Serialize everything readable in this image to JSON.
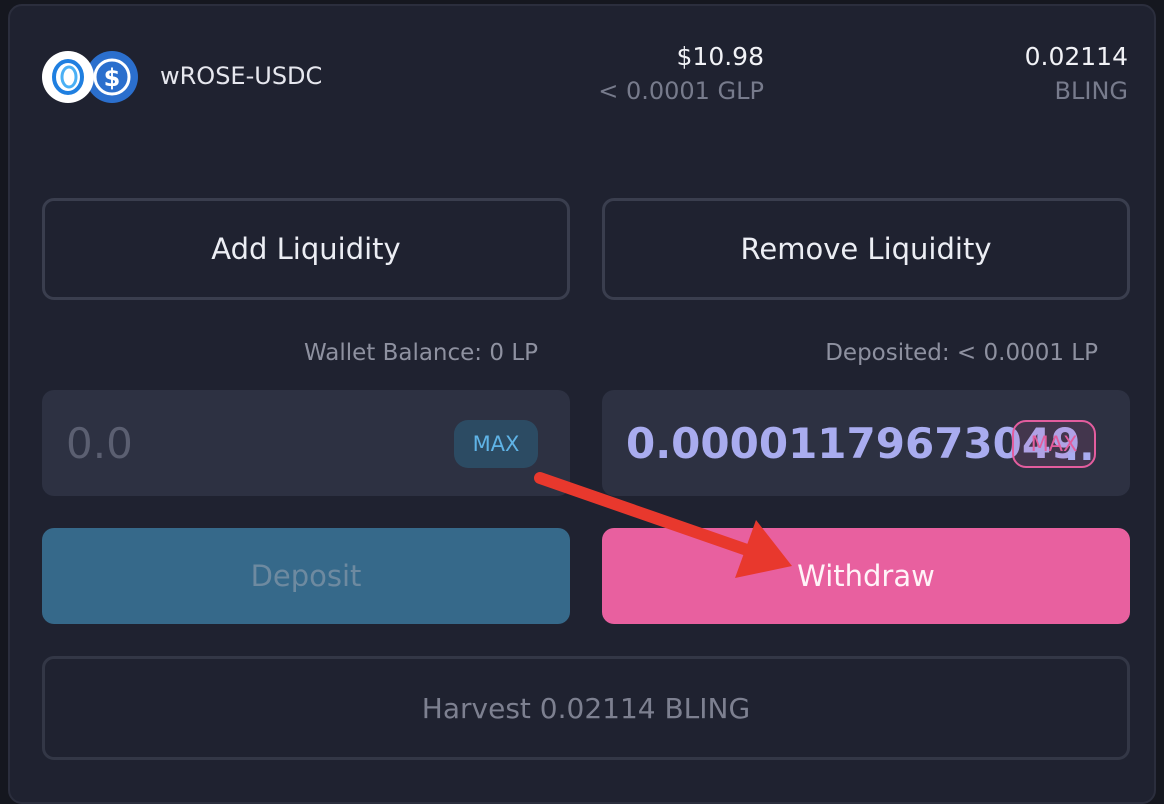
{
  "pool": {
    "pair_name": "wROSE-USDC",
    "tokens": [
      {
        "name": "wROSE",
        "icon": "rose-token-icon",
        "color": "#2b6fcd"
      },
      {
        "name": "USDC",
        "icon": "usdc-token-icon",
        "color": "#2b6fcd"
      }
    ],
    "tvl_value": "$10.98",
    "tvl_sub": "< 0.0001 GLP",
    "reward_value": "0.02114",
    "reward_sub": "BLING"
  },
  "tabs": {
    "add_label": "Add Liquidity",
    "remove_label": "Remove Liquidity"
  },
  "deposit_panel": {
    "balance_label": "Wallet Balance: 0 LP",
    "input_placeholder": "0.0",
    "max_label": "MAX",
    "button_label": "Deposit"
  },
  "withdraw_panel": {
    "balance_label": "Deposited: < 0.0001 LP",
    "input_value": "0.00001179673049",
    "ellipsis": "..",
    "max_label": "MAX",
    "button_label": "Withdraw"
  },
  "harvest": {
    "label": "Harvest 0.02114 BLING"
  },
  "colors": {
    "background": "#1f2230",
    "accent_pink": "#e8609f",
    "accent_blue": "#36698a",
    "annotation_arrow": "#e8382d"
  }
}
